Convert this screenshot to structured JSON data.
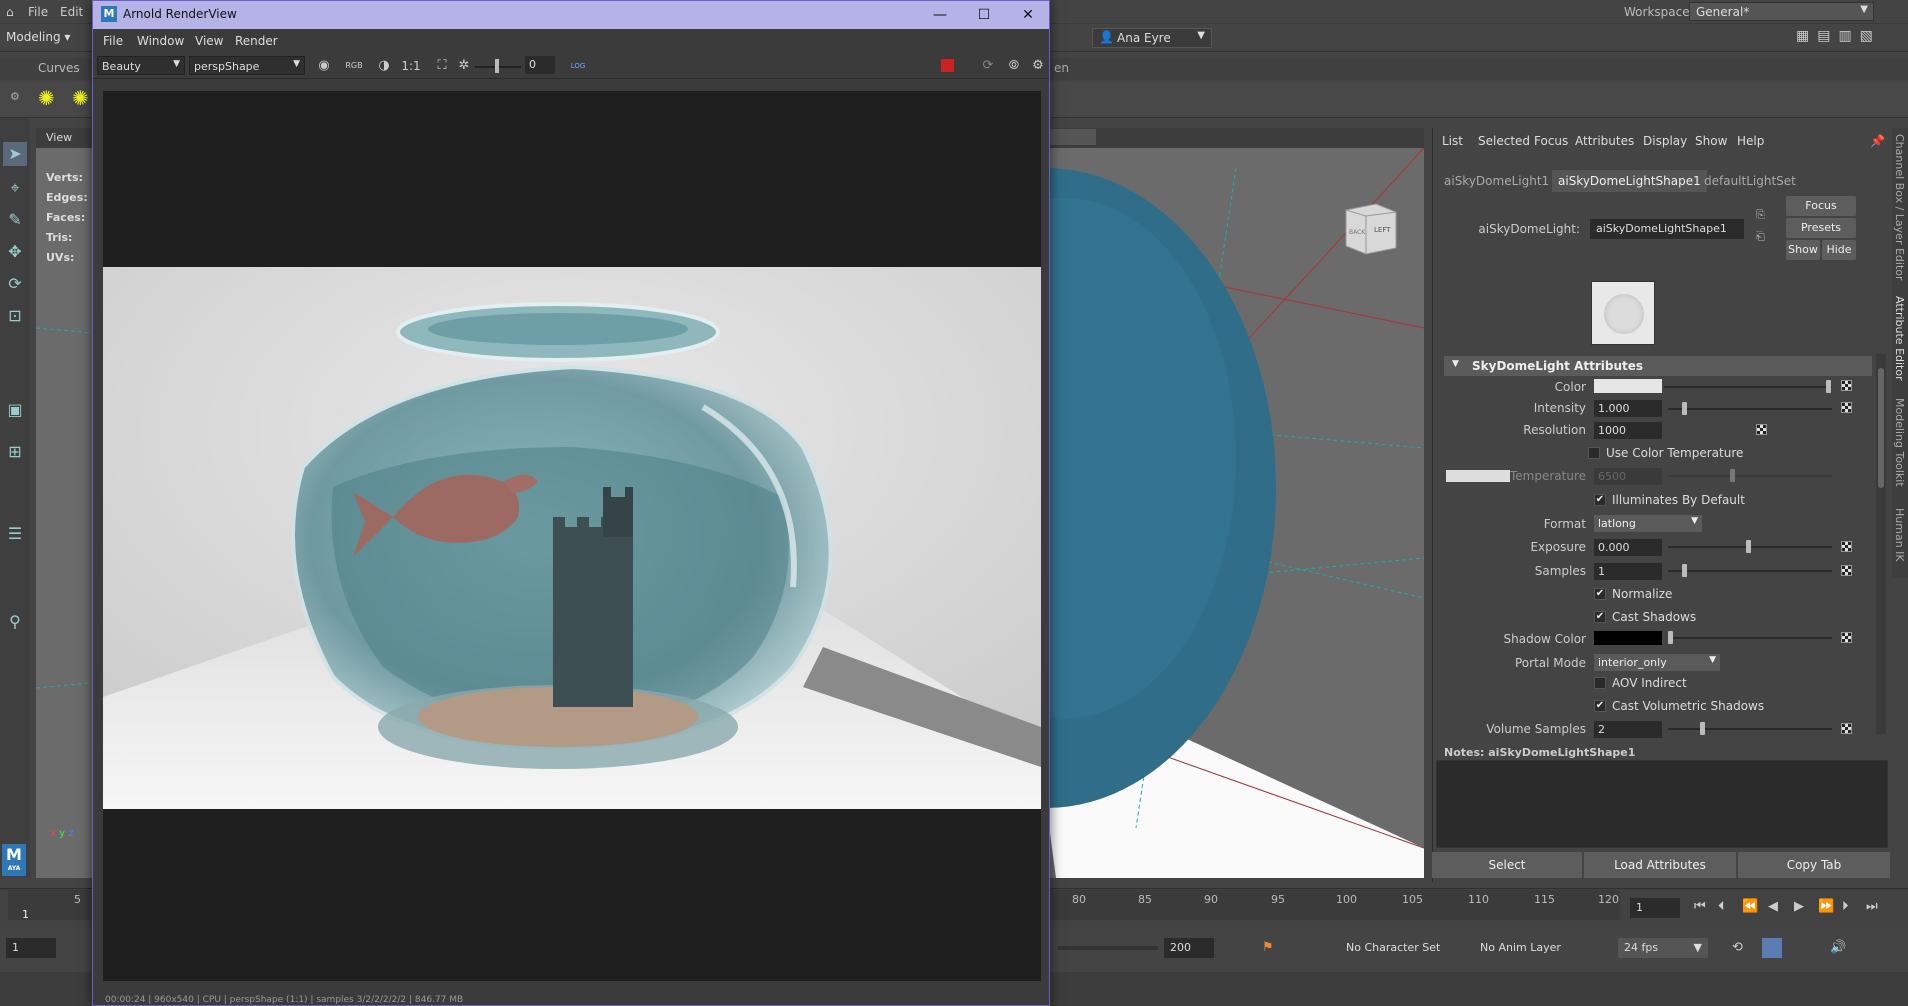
{
  "maya": {
    "menus": [
      "File",
      "Edit"
    ],
    "mode": "Modeling",
    "workspace_label": "Workspace:",
    "workspace_value": "General*",
    "user": "Ana Eyre",
    "shelf_tabs": [
      "Curves"
    ],
    "viewport_menus": [
      "View"
    ],
    "stats_labels": [
      "Verts:",
      "Edges:",
      "Faces:",
      "Tris:",
      "UVs:"
    ],
    "viewcube": {
      "back": "BACK",
      "left": "LEFT"
    },
    "logo": {
      "letter": "M",
      "sub": "AYA"
    }
  },
  "attribute_editor": {
    "menus": [
      "List",
      "Selected",
      "Focus",
      "Attributes",
      "Display",
      "Show",
      "Help"
    ],
    "tabs": [
      "aiSkyDomeLight1",
      "aiSkyDomeLightShape1",
      "defaultLightSet"
    ],
    "active_tab": "aiSkyDomeLightShape1",
    "node_label": "aiSkyDomeLight:",
    "node_name": "aiSkyDomeLightShape1",
    "focus_btn": "Focus",
    "presets_btn": "Presets",
    "show_btn": "Show",
    "hide_btn": "Hide",
    "section_title": "SkyDomeLight Attributes",
    "attrs": {
      "color_label": "Color",
      "intensity_label": "Intensity",
      "intensity_value": "1.000",
      "resolution_label": "Resolution",
      "resolution_value": "1000",
      "use_color_temp": "Use Color Temperature",
      "temperature_label": "Temperature",
      "temperature_value": "6500",
      "illuminates": "Illuminates By Default",
      "format_label": "Format",
      "format_value": "latlong",
      "exposure_label": "Exposure",
      "exposure_value": "0.000",
      "samples_label": "Samples",
      "samples_value": "1",
      "normalize": "Normalize",
      "cast_shadows": "Cast Shadows",
      "shadow_color_label": "Shadow Color",
      "portal_mode_label": "Portal Mode",
      "portal_mode_value": "interior_only",
      "aov_indirect": "AOV Indirect",
      "cast_vol_shadows": "Cast Volumetric Shadows",
      "volume_samples_label": "Volume Samples",
      "volume_samples_value": "2"
    },
    "notes_label": "Notes:  aiSkyDomeLightShape1",
    "bottom_buttons": [
      "Select",
      "Load Attributes",
      "Copy Tab"
    ]
  },
  "side_tabs": [
    "Channel Box / Layer Editor",
    "Attribute Editor",
    "Modeling Toolkit",
    "Human IK"
  ],
  "timeline": {
    "ticks": [
      "1",
      "5",
      "80",
      "85",
      "90",
      "95",
      "100",
      "105",
      "110",
      "115",
      "120"
    ],
    "current_frame": "1",
    "range_start": "1",
    "range_end": "200",
    "character_set": "No Character Set",
    "anim_layer": "No Anim Layer",
    "fps": "24 fps"
  },
  "renderview": {
    "title": "Arnold RenderView",
    "menus": [
      "File",
      "Window",
      "View",
      "Render"
    ],
    "aov": "Beauty",
    "camera": "perspShape",
    "ratio": "1:1",
    "exposure": "0",
    "log_label": "LOG",
    "status": "00:00:24 | 960x540 | CPU | perspShape (1:1) | samples 3/2/2/2/2/2 | 846.77 MB"
  },
  "colors": {
    "accent": "#b4b2e6",
    "sphere": "#2e6f8a",
    "glass": "#6fa5ad"
  }
}
